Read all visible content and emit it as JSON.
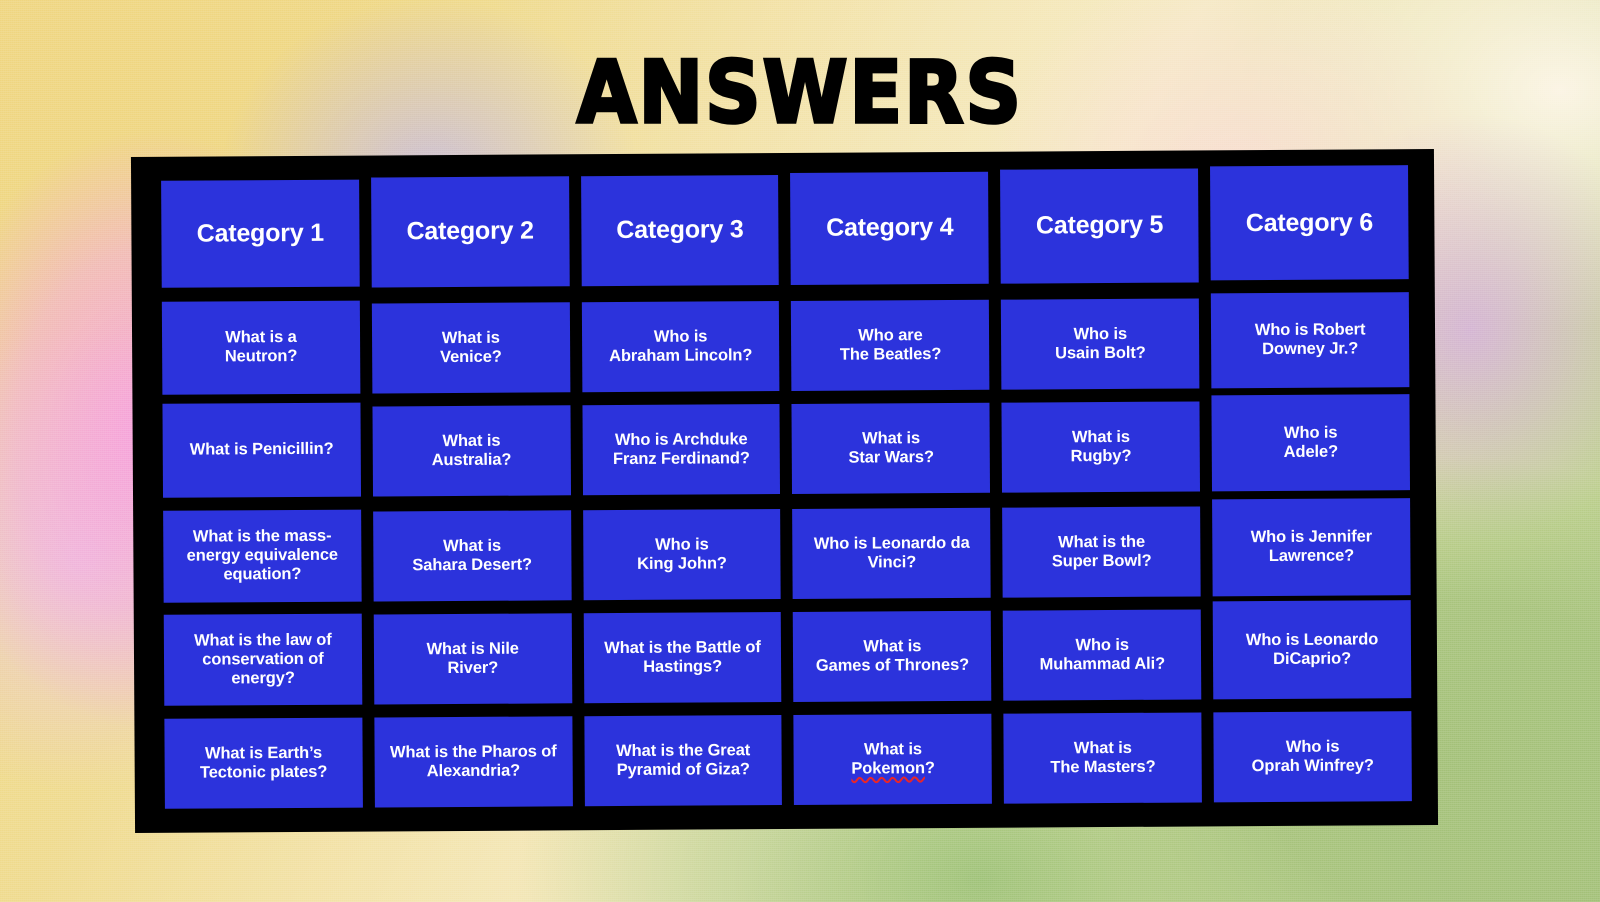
{
  "page": {
    "title": "ANSWERS",
    "accent_blue": "#2c33dc",
    "frame_black": "#000000",
    "text_white": "#ffffff",
    "spellcheck_red": "#e8262a"
  },
  "board": {
    "categories": [
      "Category 1",
      "Category 2",
      "Category 3",
      "Category 4",
      "Category 5",
      "Category 6"
    ],
    "rows": [
      [
        "What is a\nNeutron?",
        "What is\nVenice?",
        "Who is\nAbraham Lincoln?",
        "Who are\nThe Beatles?",
        "Who is\nUsain Bolt?",
        "Who is Robert\nDowney Jr.?"
      ],
      [
        "What is Penicillin?",
        "What is\nAustralia?",
        "Who is Archduke\nFranz Ferdinand?",
        "What is\nStar Wars?",
        "What is\nRugby?",
        "Who is\nAdele?"
      ],
      [
        "What is the mass-energy equivalence equation?",
        "What is\nSahara Desert?",
        "Who is\nKing John?",
        "Who is Leonardo da Vinci?",
        "What is the\nSuper Bowl?",
        "Who is Jennifer\nLawrence?"
      ],
      [
        "What is the law of conservation of energy?",
        "What is Nile\nRiver?",
        "What is the Battle of\nHastings?",
        "What is\nGames of Thrones?",
        "Who is\nMuhammad Ali?",
        "Who is Leonardo\nDiCaprio?"
      ],
      [
        "What is Earth’s\nTectonic plates?",
        "What is the Pharos of\nAlexandria?",
        "What is the Great\nPyramid of Giza?",
        "What is\nPokemon?",
        "What is\nThe Masters?",
        "Who is\nOprah Winfrey?"
      ]
    ],
    "spellchecked_cells": [
      {
        "row": 4,
        "col": 3,
        "word": "Pokemon"
      }
    ]
  }
}
